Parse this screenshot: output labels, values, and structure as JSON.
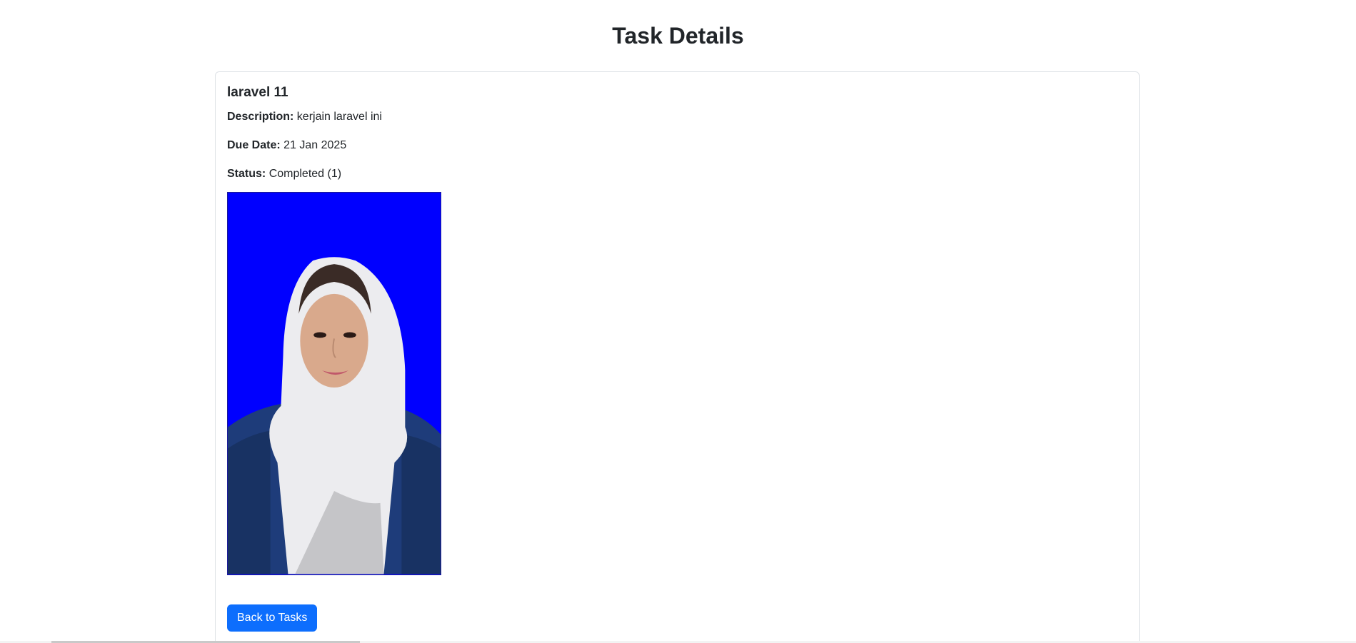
{
  "page": {
    "title": "Task Details"
  },
  "task": {
    "title": "laravel 11",
    "description_label": "Description:",
    "description_value": "kerjain laravel ini",
    "due_date_label": "Due Date:",
    "due_date_value": "21 Jan 2025",
    "status_label": "Status:",
    "status_value": "Completed (1)"
  },
  "actions": {
    "back_label": "Back to Tasks"
  },
  "colors": {
    "primary": "#0d6efd",
    "photo_background": "#0000ff",
    "border": "#dee2e6"
  }
}
